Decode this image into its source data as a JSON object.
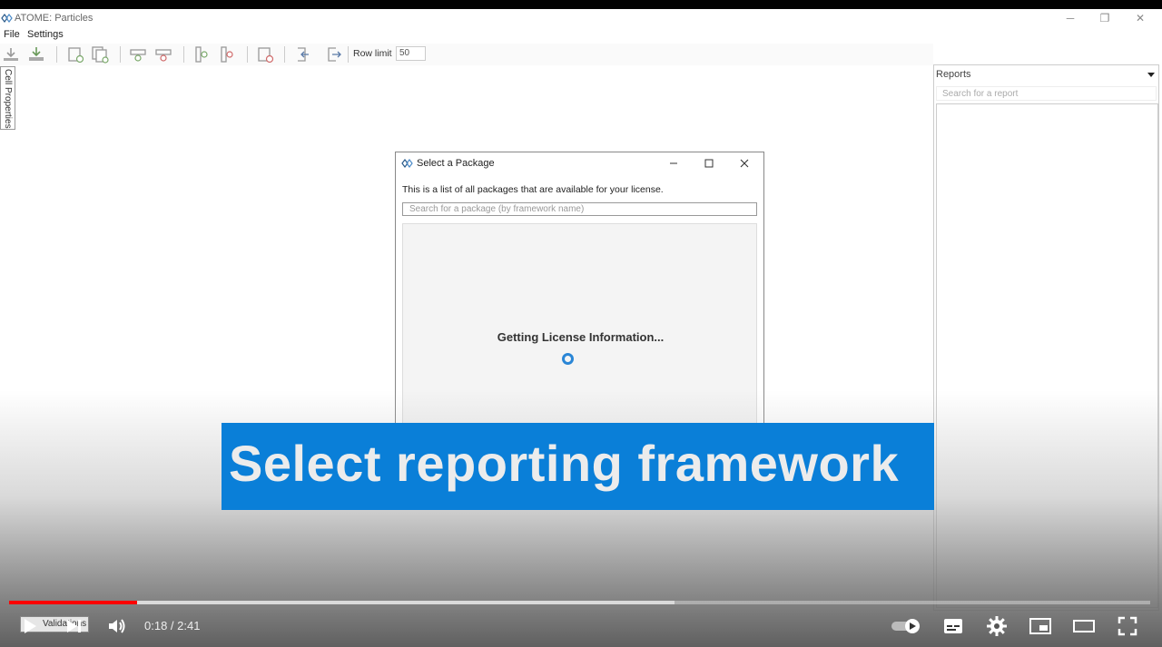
{
  "window": {
    "title": "ATOME: Particles",
    "controls": [
      "─",
      "❐",
      "✕"
    ]
  },
  "menu": {
    "file": "File",
    "settings": "Settings"
  },
  "toolbar": {
    "icons": [
      "download-icon",
      "download-alt-icon",
      "doc-check-icon",
      "doc-copy-icon",
      "row-add-icon",
      "row-remove-icon",
      "col-add-icon",
      "col-remove-icon",
      "doc-delete-icon",
      "import-icon",
      "export-icon"
    ],
    "row_limit_label": "Row limit",
    "row_limit_value": "50"
  },
  "side_tab": {
    "label": "Cell Properties"
  },
  "reports_panel": {
    "title": "Reports",
    "search_placeholder": "Search for a report"
  },
  "dialog": {
    "title": "Select a Package",
    "description": "This is a list of all packages that are available for your license.",
    "search_placeholder": "Search for a package (by framework name)",
    "loading_text": "Getting License Information..."
  },
  "caption": {
    "text": "Select reporting framework"
  },
  "video": {
    "current_time": "0:18",
    "duration": "2:41",
    "time_display": "0:18 / 2:41",
    "played_fraction": 0.112,
    "buffered_fraction": 0.583,
    "validations_label": "Validations"
  },
  "colors": {
    "accent": "#0a7fd8",
    "progress": "#ff0000",
    "spinner": "#2a86d6"
  }
}
